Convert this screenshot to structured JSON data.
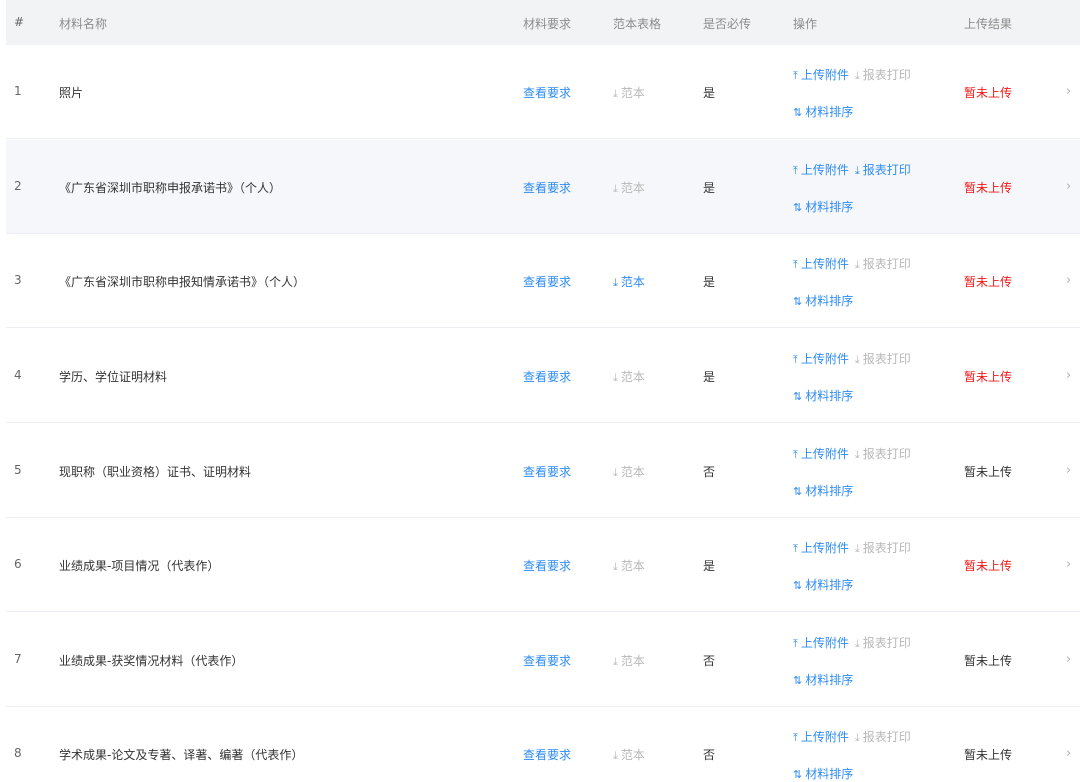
{
  "header": {
    "index": "#",
    "name": "材料名称",
    "requirement": "材料要求",
    "template": "范本表格",
    "required": "是否必传",
    "operations": "操作",
    "result": "上传结果"
  },
  "labels": {
    "view_requirement": "查看要求",
    "template": "范本",
    "upload": "上传附件",
    "print": "报表打印",
    "sort": "材料排序"
  },
  "rows": [
    {
      "index": "1",
      "name": "照片",
      "required": "是",
      "result": "暂未上传"
    },
    {
      "index": "2",
      "name": "《广东省深圳市职称申报承诺书》（个人）",
      "required": "是",
      "result": "暂未上传"
    },
    {
      "index": "3",
      "name": "《广东省深圳市职称申报知情承诺书》（个人）",
      "required": "是",
      "result": "暂未上传"
    },
    {
      "index": "4",
      "name": "学历、学位证明材料",
      "required": "是",
      "result": "暂未上传"
    },
    {
      "index": "5",
      "name": "现职称（职业资格）证书、证明材料",
      "required": "否",
      "result": "暂未上传"
    },
    {
      "index": "6",
      "name": "业绩成果-项目情况（代表作）",
      "required": "是",
      "result": "暂未上传"
    },
    {
      "index": "7",
      "name": "业绩成果-获奖情况材料（代表作）",
      "required": "否",
      "result": "暂未上传"
    },
    {
      "index": "8",
      "name": "学术成果-论文及专著、译著、编著（代表作）",
      "required": "否",
      "result": "暂未上传"
    }
  ],
  "icons": {
    "upload": "upload-icon",
    "download": "download-icon",
    "sort": "sort-icon",
    "chevron": "chevron-right-icon"
  },
  "colors": {
    "link": "#2f8cf0",
    "disabled": "#b8b8b8",
    "danger": "#f01818"
  }
}
